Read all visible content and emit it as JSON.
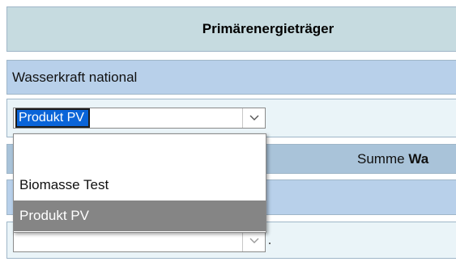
{
  "header": {
    "title": "Primärenergieträger"
  },
  "source_row": {
    "label": "Wasserkraft national"
  },
  "product_select": {
    "selected_value": "Produkt PV",
    "options": [
      "",
      "Biomasse Test",
      "Produkt PV"
    ]
  },
  "summe_row": {
    "label": "Summe",
    "strong_text": "Wa"
  },
  "second_select": {
    "selected_value": ""
  },
  "icons": {
    "dropdown_arrow": "chevron-down-icon"
  },
  "colors": {
    "header_bg": "#c6dbe0",
    "row_blue": "#b8d0ea",
    "summe_bg": "#a9c3d9",
    "selection_highlight": "#0a64d8",
    "hover_option": "#858585"
  }
}
